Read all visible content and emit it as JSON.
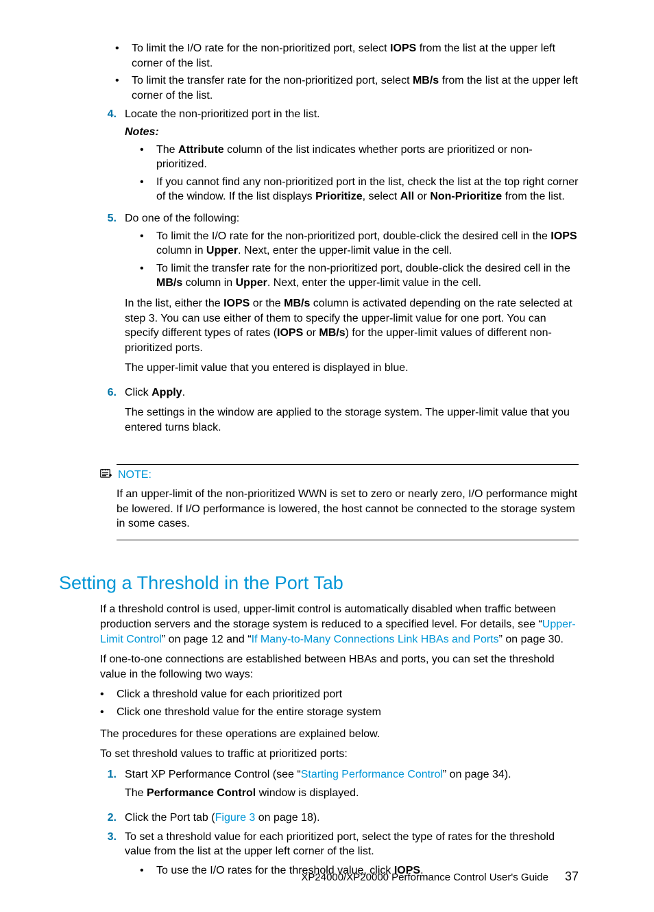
{
  "step3": {
    "b1": {
      "pre": "To limit the I/O rate for the non-prioritized port, select ",
      "bold": "IOPS",
      "post": " from the list at the upper left corner of the list."
    },
    "b2": {
      "pre": "To limit the transfer rate for the non-prioritized port, select ",
      "bold": "MB/s",
      "post": " from the list at the upper left corner of the list."
    }
  },
  "step4": {
    "num": "4.",
    "text": "Locate the non-prioritized port in the list.",
    "notes_label": "Notes:",
    "n1": {
      "pre": "The ",
      "bold": "Attribute",
      "post": " column of the list indicates whether ports are prioritized or non-prioritized."
    },
    "n2": {
      "a": "If you cannot find any non-prioritized port in the list, check the list at the top right corner of the window. If the list displays ",
      "b1": "Prioritize",
      "b": ", select ",
      "b2": "All",
      "c": " or ",
      "b3": "Non-Prioritize",
      "d": " from the list."
    }
  },
  "step5": {
    "num": "5.",
    "text": "Do one of the following:",
    "b1": {
      "a": "To limit the I/O rate for the non-prioritized port, double-click the desired cell in the ",
      "b1": "IOPS",
      "b": " column in ",
      "b2": "Upper",
      "c": ". Next, enter the upper-limit value in the cell."
    },
    "b2": {
      "a": "To limit the transfer rate for the non-prioritized port, double-click the desired cell in the ",
      "b1": "MB/s",
      "b": " column in ",
      "b2": "Upper",
      "c": ". Next, enter the upper-limit value in the cell."
    },
    "p1": {
      "a": "In the list, either the ",
      "b1": "IOPS",
      "b": " or the ",
      "b2": "MB/s",
      "c": " column is activated depending on the rate selected at step 3. You can use either of them to specify the upper-limit value for one port. You can specify different types of rates (",
      "b3": "IOPS",
      "d": " or ",
      "b4": "MB/s",
      "e": ") for the upper-limit values of different non-prioritized ports."
    },
    "p2": "The upper-limit value that you entered is displayed in blue."
  },
  "step6": {
    "num": "6.",
    "text_pre": "Click ",
    "text_bold": "Apply",
    "text_post": ".",
    "p1": "The settings in the window are applied to the storage system. The upper-limit value that you entered turns black."
  },
  "note": {
    "head": "NOTE:",
    "body": "If an upper-limit of the non-prioritized WWN is set to zero or nearly zero, I/O performance might be lowered. If I/O performance is lowered, the host cannot be connected to the storage system in some cases."
  },
  "section": {
    "title": "Setting a Threshold in the Port Tab",
    "p1": {
      "a": "If a threshold control is used, upper-limit control is automatically disabled when traffic between production servers and the storage system is reduced to a specified level. For details, see “",
      "l1": "Upper-Limit Control",
      "b": "” on page 12 and “",
      "l2": "If Many-to-Many Connections Link HBAs and Ports",
      "c": "” on page 30."
    },
    "p2": "If one-to-one connections are established between HBAs and ports, you can set the threshold value in the following two ways:",
    "b1": "Click a threshold value for each prioritized port",
    "b2": "Click one threshold value for the entire storage system",
    "p3": "The procedures for these operations are explained below.",
    "p4": "To set threshold values to traffic at prioritized ports:",
    "s1": {
      "num": "1.",
      "a": "Start XP Performance Control (see “",
      "l": "Starting Performance Control",
      "b": "” on page 34).",
      "sub_a": "The ",
      "sub_b": "Performance Control",
      "sub_c": " window is displayed."
    },
    "s2": {
      "num": "2.",
      "a": "Click the Port tab (",
      "l": "Figure 3",
      "b": " on page 18)."
    },
    "s3": {
      "num": "3.",
      "a": "To set a threshold value for each prioritized port, select the type of rates for the threshold value from the list at the upper left corner of the list.",
      "sb_a": "To use the I/O rates for the threshold value, click ",
      "sb_b": "IOPS",
      "sb_c": "."
    }
  },
  "footer": {
    "title": "XP24000/XP20000 Performance Control User's Guide",
    "page": "37"
  }
}
